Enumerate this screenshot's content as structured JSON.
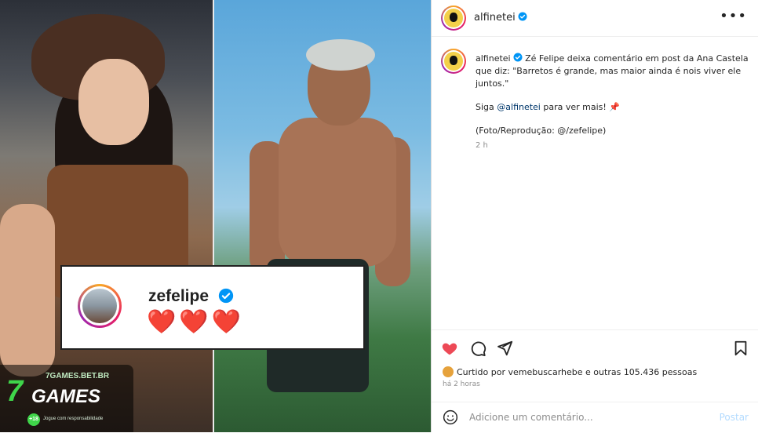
{
  "image": {
    "comment_card": {
      "username": "zefelipe",
      "hearts": "❤️❤️❤️"
    },
    "watermark": {
      "digit": "7",
      "brand": "GAMES",
      "site": "7GAMES.BET.BR",
      "age": "+18",
      "notice": "Jogue com responsabilidade"
    }
  },
  "header": {
    "username": "alfinetei",
    "more": "•••"
  },
  "caption": {
    "username": "alfinetei",
    "text": "Zé Felipe deixa comentário em post da Ana Castela que diz: \"Barretos é grande, mas maior ainda é nois viver ele juntos.\"",
    "line2_prefix": "Siga ",
    "mention": "@alfinetei",
    "line2_suffix": " para ver mais! 📌",
    "credit": "(Foto/Reprodução: @/zefelipe)",
    "time": "2 h"
  },
  "engagement": {
    "liked_by_prefix": "Curtido por ",
    "liked_by_user": "vemebuscarhebe",
    "liked_by_suffix": " e outras 105.436 pessoas",
    "posted": "há 2 horas"
  },
  "comment_box": {
    "placeholder": "Adicione um comentário...",
    "post_label": "Postar"
  },
  "colors": {
    "like_red": "#ed4956",
    "verified_blue": "#0095f6",
    "post_disabled": "#b3dbff"
  }
}
